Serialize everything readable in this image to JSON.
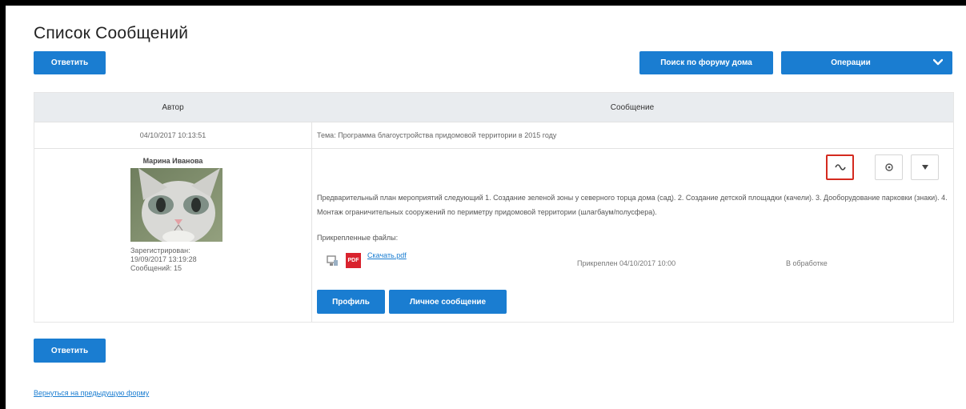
{
  "page": {
    "title": "Список Сообщений"
  },
  "toolbar": {
    "reply_label": "Ответить",
    "search_form_label": "Поиск по форуму дома",
    "operations_label": "Операции"
  },
  "table": {
    "columns": [
      "Автор",
      "Сообщение"
    ],
    "date": "04/10/2017 10:13:51",
    "topic": "Тема: Программа благоустройства придомовой территории в 2015 году"
  },
  "post": {
    "author_name": "Марина Иванова",
    "registered_label": "Зарегистрирован:",
    "registered_date": "19/09/2017 13:19:28",
    "messages_count_label": "Сообщений: 15",
    "text": "Предварительный план мероприятий следующий 1. Создание зеленой зоны у северного торца дома (сад). 2. Создание детской площадки (качели). 3. Дооборудование парковки (знаки). 4. Монтаж ограничительных сооружений по периметру придомовой территории (шлагбаум/полусфера).",
    "files_label": "Прикрепленные файлы:",
    "file_name": "Скачать.pdf",
    "file_attached": "Прикреплен 04/10/2017 10:00",
    "file_status": "В обработке",
    "profile_button": "Профиль",
    "private_message_button": "Личное сообщение"
  },
  "footer": {
    "reply_label": "Ответить",
    "back_link": "Вернуться на предыдущую форму"
  },
  "colors": {
    "accent": "#1a7dd1",
    "header_bg": "#e9ecef",
    "highlight": "#d42a1f",
    "pdf": "#d9232e"
  }
}
